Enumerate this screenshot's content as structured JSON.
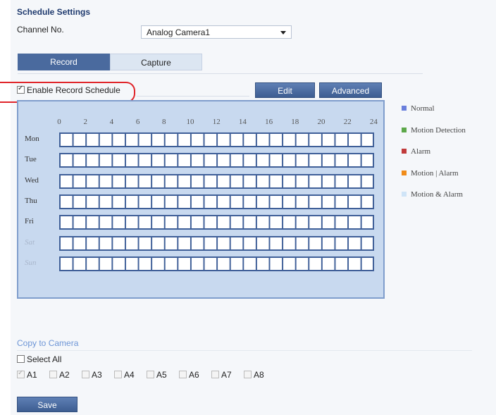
{
  "title": "Schedule Settings",
  "channel": {
    "label": "Channel No.",
    "value": "Analog Camera1"
  },
  "tabs": [
    {
      "label": "Record",
      "active": true
    },
    {
      "label": "Capture",
      "active": false
    }
  ],
  "enable_schedule": {
    "label": "Enable Record Schedule",
    "checked": true
  },
  "buttons": {
    "edit": "Edit",
    "advanced": "Advanced",
    "save": "Save"
  },
  "schedule": {
    "hours": [
      "0",
      "2",
      "4",
      "6",
      "8",
      "10",
      "12",
      "14",
      "16",
      "18",
      "20",
      "22",
      "24"
    ],
    "days": [
      "Mon",
      "Tue",
      "Wed",
      "Thu",
      "Fri",
      "Sat",
      "Sun"
    ]
  },
  "legend": [
    {
      "label": "Normal",
      "color": "#6a7fdc"
    },
    {
      "label": "Motion Detection",
      "color": "#5da84a"
    },
    {
      "label": "Alarm",
      "color": "#c13b3b"
    },
    {
      "label": "Motion | Alarm",
      "color": "#f08c1a"
    },
    {
      "label": "Motion & Alarm",
      "color": "#cfe4f7"
    }
  ],
  "copy": {
    "title": "Copy to Camera",
    "select_all": "Select All",
    "cameras": [
      {
        "label": "A1",
        "checked": true,
        "disabled": true
      },
      {
        "label": "A2",
        "checked": false,
        "disabled": false
      },
      {
        "label": "A3",
        "checked": false,
        "disabled": false
      },
      {
        "label": "A4",
        "checked": false,
        "disabled": false
      },
      {
        "label": "A5",
        "checked": false,
        "disabled": false
      },
      {
        "label": "A6",
        "checked": false,
        "disabled": false
      },
      {
        "label": "A7",
        "checked": false,
        "disabled": false
      },
      {
        "label": "A8",
        "checked": false,
        "disabled": false
      }
    ]
  }
}
